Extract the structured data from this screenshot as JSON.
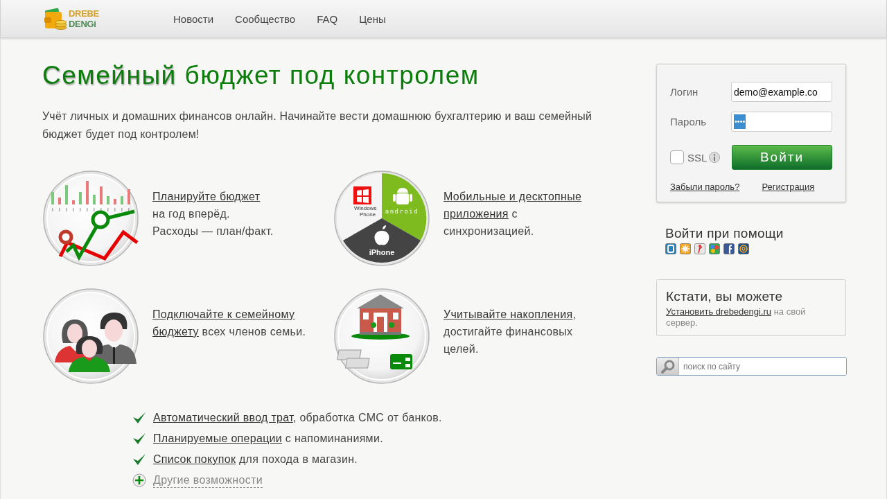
{
  "header": {
    "logo": {
      "top": "DREBE",
      "bottom": "DENGi"
    },
    "nav": [
      "Новости",
      "Сообщество",
      "FAQ",
      "Цены"
    ]
  },
  "headline": "**Семейный** бюджет под контролем",
  "intro": "Учёт личных и домашних финансов онлайн. Начинайте вести домашнюю бухгалтерию и ваш семейный бюджет будет под контролем!",
  "features": [
    {
      "kind": "chart",
      "lines": [
        [
          {
            "text": "Планируйте бюджет",
            "link": true
          }
        ],
        [
          {
            "text": "на год вперёд."
          }
        ],
        [
          {
            "text": "Расходы — план/факт."
          }
        ]
      ]
    },
    {
      "kind": "platforms",
      "labels": {
        "windows": "Windows Phone",
        "android": "android",
        "apple": "iPhone"
      },
      "lines": [
        [
          {
            "text": "Мобильные и десктопные",
            "link": true
          }
        ],
        [
          {
            "text": "приложения",
            "link": true
          },
          {
            "text": " с"
          }
        ],
        [
          {
            "text": "синхронизацией."
          }
        ]
      ]
    },
    {
      "kind": "family",
      "lines": [
        [
          {
            "text": "Подключайте к семейному",
            "link": true
          }
        ],
        [
          {
            "text": "бюджету",
            "link": true
          },
          {
            "text": " всех членов семьи."
          }
        ]
      ]
    },
    {
      "kind": "savings",
      "lines": [
        [
          {
            "text": "Учитывайте накопления",
            "link": true
          },
          {
            "text": ","
          }
        ],
        [
          {
            "text": "достигайте финансовых"
          }
        ],
        [
          {
            "text": "целей."
          }
        ]
      ]
    }
  ],
  "checklist": [
    {
      "kind": "check",
      "parts": [
        {
          "text": "Автоматический ввод трат",
          "link": true
        },
        {
          "text": ", обработка СМС от банков."
        }
      ]
    },
    {
      "kind": "check",
      "parts": [
        {
          "text": "Планируемые операции",
          "link": true
        },
        {
          "text": " с напоминаниями."
        }
      ]
    },
    {
      "kind": "check",
      "parts": [
        {
          "text": "Список покупок",
          "link": true
        },
        {
          "text": " для похода в магазин."
        }
      ]
    },
    {
      "kind": "more",
      "parts": [
        {
          "text": "Другие возможности",
          "link": true
        }
      ]
    }
  ],
  "login": {
    "login_label": "Логин",
    "login_value": "demo@example.co",
    "password_label": "Пароль",
    "password_mask": "••••",
    "ssl": {
      "label": "SSL",
      "checked": false
    },
    "submit": "Войти",
    "forgot": "Забыли пароль?",
    "register": "Регистрация"
  },
  "social": {
    "title": "Войти при помощи",
    "providers": [
      {
        "kind": "b",
        "color": "#2d7fb8"
      },
      {
        "kind": "sun",
        "color": "#f6a623"
      },
      {
        "kind": "figure",
        "color": "#e8e8e8"
      },
      {
        "kind": "dots",
        "color": "#34a853"
      },
      {
        "kind": "f",
        "color": "#3b5998"
      },
      {
        "kind": "at",
        "color": "#1b4f8c"
      }
    ]
  },
  "tip": {
    "title": "Кстати, вы можете",
    "link": "Установить drebedengi.ru",
    "text": " на свой сервер."
  },
  "search": {
    "placeholder": "поиск по сайту"
  }
}
